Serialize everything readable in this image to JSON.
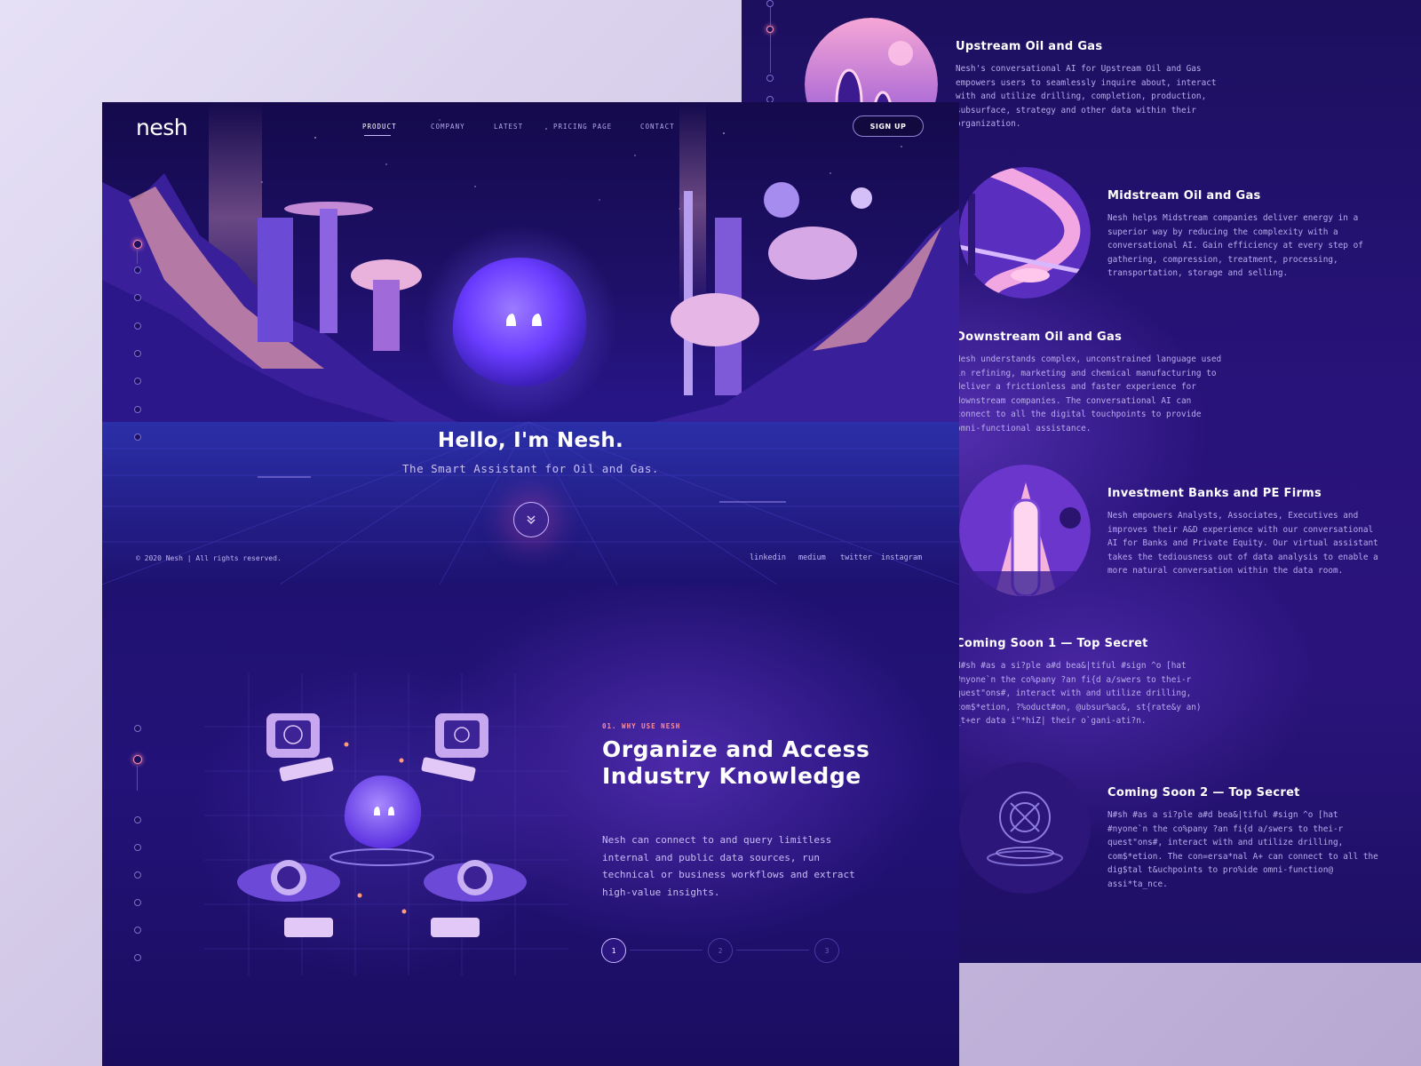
{
  "brand": {
    "logo": "nesh"
  },
  "nav": {
    "items": [
      {
        "label": "PRODUCT",
        "active": true
      },
      {
        "label": "COMPANY",
        "active": false
      },
      {
        "label": "LATEST",
        "active": false
      },
      {
        "label": "PRICING PAGE",
        "active": false
      },
      {
        "label": "CONTACT",
        "active": false
      }
    ],
    "signup_label": "SIGN UP"
  },
  "hero": {
    "title": "Hello, I'm Nesh.",
    "subtitle": "The Smart Assistant for Oil and Gas.",
    "scroll_icon": "chevron-double-down-icon"
  },
  "footer": {
    "copyright": "© 2020 Nesh | All rights reserved.",
    "social": [
      "linkedin",
      "medium",
      "twitter",
      "instagram"
    ]
  },
  "why": {
    "eyebrow": "01. WHY USE NESH",
    "title": "Organize and Access Industry Knowledge",
    "body": "Nesh can connect to and query limitless internal and public data sources, run technical or business workflows and extract high-value insights.",
    "steps": [
      "1",
      "2",
      "3"
    ],
    "active_step": 1
  },
  "services": [
    {
      "title": "Upstream Oil and Gas",
      "body": "Nesh's conversational AI for Upstream Oil and Gas empowers users to seamlessly inquire about, interact with and utilize drilling, completion, production, subsurface, strategy and other data within their organization."
    },
    {
      "title": "Midstream Oil and Gas",
      "body": "Nesh helps Midstream companies deliver energy in a superior way by reducing the complexity with a conversational AI. Gain efficiency at every step of gathering, compression, treatment, processing, transportation, storage and selling."
    },
    {
      "title": "Downstream Oil and Gas",
      "body": "Nesh understands complex, unconstrained language used in refining, marketing and chemical manufacturing to deliver a frictionless and faster experience for downstream companies. The conversational AI can connect to all the digital touchpoints to provide omni-functional assistance."
    },
    {
      "title": "Investment Banks and PE Firms",
      "body": "Nesh empowers Analysts, Associates, Executives and improves their A&D experience with our conversational AI for Banks and Private Equity. Our virtual assistant takes the tediousness out of data analysis to enable a more natural conversation within the data room."
    },
    {
      "title": "Coming Soon 1 — Top Secret",
      "body": "N#sh #as a si?ple a#d bea&|tiful #sign ^o [hat #nyone`n the co%pany ?an fi{d a/swers to thei-r quest\"ons#, interact with and utilize drilling, com$*etion, ?%oduct#on, @ubsur%ac&, st{rate&y an) _t+er data i\"*hiZ| their o`gani-ati?n."
    },
    {
      "title": "Coming Soon 2 — Top Secret",
      "body": "N#sh #as a si?ple a#d bea&|tiful #sign ^o [hat #nyone`n the co%pany ?an fi{d a/swers to thei-r quest\"ons#, interact with and utilize drilling, com$*etion. The con=ersa*nal A+ can connect to all the dig$tal t&uchpoints to pro%ide omni-function@ assi*ta_nce."
    }
  ],
  "colors": {
    "accent": "#ff8fb0",
    "panel_dark": "#1c0f5e",
    "panel_mid": "#2a147c",
    "text_muted": "#b9acec"
  }
}
